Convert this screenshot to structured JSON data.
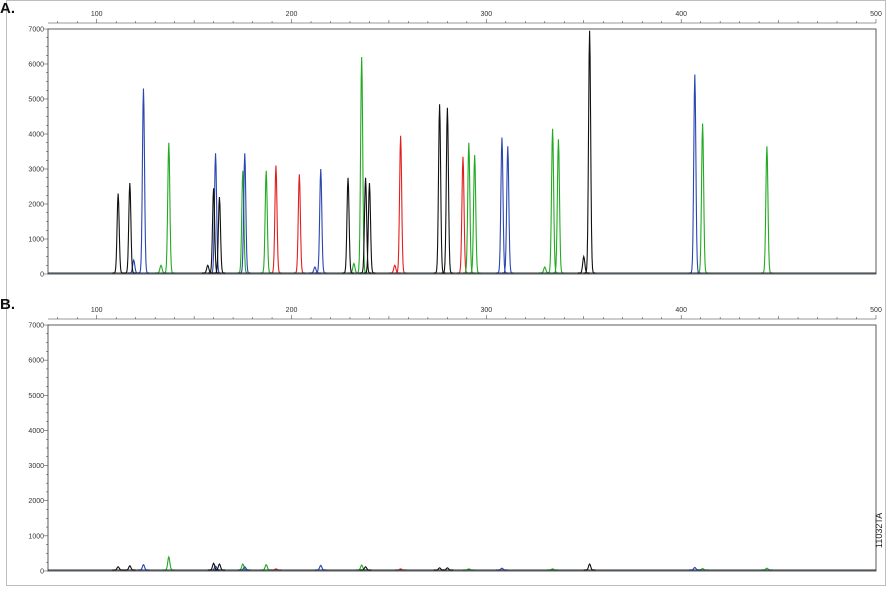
{
  "figure_code": "11032TA",
  "colors": {
    "black": "#111111",
    "blue": "#2a46b0",
    "green": "#22aa22",
    "red": "#e21f1f",
    "axis": "#333333",
    "grid": "#cccccc"
  },
  "chart_data": [
    {
      "type": "line",
      "panel_label": "A.",
      "title": "",
      "xlabel": "",
      "ylabel": "",
      "xlim": [
        75,
        500
      ],
      "ylim": [
        0,
        7000
      ],
      "x_ticks": [
        "100",
        "200",
        "300",
        "400",
        "500"
      ],
      "y_ticks": [
        "0",
        "1000",
        "2000",
        "3000",
        "4000",
        "5000",
        "6000",
        "7000"
      ],
      "grid": "off",
      "legend": "none",
      "baseline": 30,
      "series": [
        {
          "color_key": "black",
          "peaks": [
            {
              "x": 111,
              "y": 2300
            },
            {
              "x": 117,
              "y": 2600
            },
            {
              "x": 160,
              "y": 2450
            },
            {
              "x": 163,
              "y": 2200
            },
            {
              "x": 229,
              "y": 2750
            },
            {
              "x": 238,
              "y": 2750
            },
            {
              "x": 240,
              "y": 2600
            },
            {
              "x": 276,
              "y": 4850
            },
            {
              "x": 280,
              "y": 4750
            },
            {
              "x": 353,
              "y": 6950
            },
            {
              "x": 350,
              "y": 500
            },
            {
              "x": 157,
              "y": 250
            }
          ]
        },
        {
          "color_key": "blue",
          "peaks": [
            {
              "x": 124,
              "y": 5300
            },
            {
              "x": 161,
              "y": 3450
            },
            {
              "x": 176,
              "y": 3450
            },
            {
              "x": 215,
              "y": 3000
            },
            {
              "x": 308,
              "y": 3900
            },
            {
              "x": 311,
              "y": 3650
            },
            {
              "x": 407,
              "y": 5700
            },
            {
              "x": 119,
              "y": 400
            },
            {
              "x": 212,
              "y": 200
            }
          ]
        },
        {
          "color_key": "green",
          "peaks": [
            {
              "x": 137,
              "y": 3750
            },
            {
              "x": 175,
              "y": 2950
            },
            {
              "x": 187,
              "y": 2950
            },
            {
              "x": 236,
              "y": 6200
            },
            {
              "x": 291,
              "y": 3750
            },
            {
              "x": 294,
              "y": 3400
            },
            {
              "x": 334,
              "y": 4150
            },
            {
              "x": 337,
              "y": 3850
            },
            {
              "x": 411,
              "y": 4300
            },
            {
              "x": 444,
              "y": 3650
            },
            {
              "x": 133,
              "y": 250
            },
            {
              "x": 232,
              "y": 300
            },
            {
              "x": 330,
              "y": 200
            }
          ]
        },
        {
          "color_key": "red",
          "peaks": [
            {
              "x": 192,
              "y": 3100
            },
            {
              "x": 204,
              "y": 2850
            },
            {
              "x": 256,
              "y": 3950
            },
            {
              "x": 288,
              "y": 3350
            },
            {
              "x": 253,
              "y": 250
            }
          ]
        }
      ]
    },
    {
      "type": "line",
      "panel_label": "B.",
      "title": "",
      "xlabel": "",
      "ylabel": "",
      "xlim": [
        75,
        500
      ],
      "ylim": [
        0,
        7000
      ],
      "x_ticks": [
        "100",
        "200",
        "300",
        "400",
        "500"
      ],
      "y_ticks": [
        "0",
        "1000",
        "2000",
        "3000",
        "4000",
        "5000",
        "6000",
        "7000"
      ],
      "grid": "off",
      "legend": "none",
      "baseline": 30,
      "series": [
        {
          "color_key": "black",
          "peaks": [
            {
              "x": 111,
              "y": 120
            },
            {
              "x": 117,
              "y": 150
            },
            {
              "x": 160,
              "y": 220
            },
            {
              "x": 163,
              "y": 200
            },
            {
              "x": 238,
              "y": 120
            },
            {
              "x": 276,
              "y": 90
            },
            {
              "x": 280,
              "y": 90
            },
            {
              "x": 353,
              "y": 200
            }
          ]
        },
        {
          "color_key": "blue",
          "peaks": [
            {
              "x": 124,
              "y": 180
            },
            {
              "x": 161,
              "y": 140
            },
            {
              "x": 176,
              "y": 120
            },
            {
              "x": 215,
              "y": 160
            },
            {
              "x": 308,
              "y": 80
            },
            {
              "x": 407,
              "y": 100
            }
          ]
        },
        {
          "color_key": "green",
          "peaks": [
            {
              "x": 137,
              "y": 400
            },
            {
              "x": 175,
              "y": 200
            },
            {
              "x": 187,
              "y": 180
            },
            {
              "x": 236,
              "y": 170
            },
            {
              "x": 291,
              "y": 60
            },
            {
              "x": 334,
              "y": 60
            },
            {
              "x": 411,
              "y": 70
            },
            {
              "x": 444,
              "y": 80
            }
          ]
        },
        {
          "color_key": "red",
          "peaks": [
            {
              "x": 192,
              "y": 60
            },
            {
              "x": 256,
              "y": 60
            }
          ]
        }
      ]
    }
  ]
}
